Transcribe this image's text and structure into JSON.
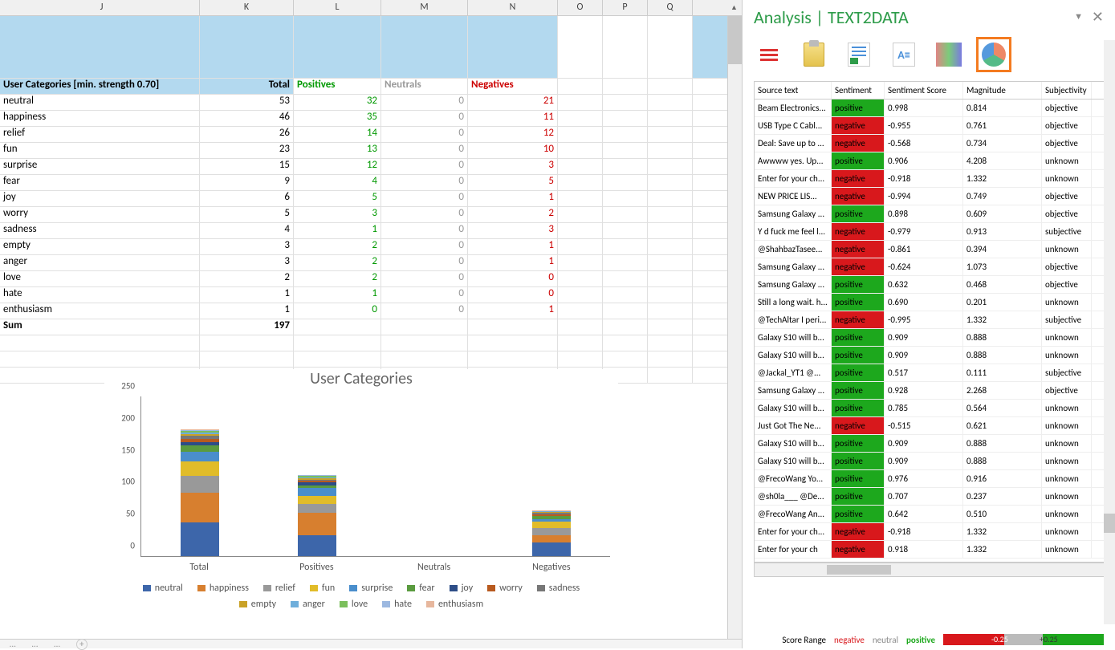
{
  "panel": {
    "title_a": "Analysis",
    "title_b": "TEXT2DATA"
  },
  "colHeaders": [
    "J",
    "K",
    "L",
    "M",
    "N",
    "O",
    "P",
    "Q"
  ],
  "table": {
    "header": {
      "j": "User Categories [min. strength 0.70]",
      "k": "Total",
      "l": "Positives",
      "m": "Neutrals",
      "n": "Negatives"
    },
    "rows": [
      {
        "j": "neutral",
        "k": 53,
        "l": 32,
        "m": 0,
        "n": 21
      },
      {
        "j": "happiness",
        "k": 46,
        "l": 35,
        "m": 0,
        "n": 11
      },
      {
        "j": "relief",
        "k": 26,
        "l": 14,
        "m": 0,
        "n": 12
      },
      {
        "j": "fun",
        "k": 23,
        "l": 13,
        "m": 0,
        "n": 10
      },
      {
        "j": "surprise",
        "k": 15,
        "l": 12,
        "m": 0,
        "n": 3
      },
      {
        "j": "fear",
        "k": 9,
        "l": 4,
        "m": 0,
        "n": 5
      },
      {
        "j": "joy",
        "k": 6,
        "l": 5,
        "m": 0,
        "n": 1
      },
      {
        "j": "worry",
        "k": 5,
        "l": 3,
        "m": 0,
        "n": 2
      },
      {
        "j": "sadness",
        "k": 4,
        "l": 1,
        "m": 0,
        "n": 3
      },
      {
        "j": "empty",
        "k": 3,
        "l": 2,
        "m": 0,
        "n": 1
      },
      {
        "j": "anger",
        "k": 3,
        "l": 2,
        "m": 0,
        "n": 1
      },
      {
        "j": "love",
        "k": 2,
        "l": 2,
        "m": 0,
        "n": 0
      },
      {
        "j": "hate",
        "k": 1,
        "l": 1,
        "m": 0,
        "n": 0
      },
      {
        "j": "enthusiasm",
        "k": 1,
        "l": 0,
        "m": 0,
        "n": 1
      }
    ],
    "sum": {
      "j": "Sum",
      "k": 197
    }
  },
  "chart_data": {
    "type": "bar",
    "title": "User Categories",
    "categories": [
      "Total",
      "Positives",
      "Neutrals",
      "Negatives"
    ],
    "ylim": [
      0,
      250
    ],
    "yticks": [
      0,
      50,
      100,
      150,
      200,
      250
    ],
    "series": [
      {
        "name": "neutral",
        "color": "#3d66aa",
        "values": [
          53,
          32,
          0,
          21
        ]
      },
      {
        "name": "happiness",
        "color": "#d77f2f",
        "values": [
          46,
          35,
          0,
          11
        ]
      },
      {
        "name": "relief",
        "color": "#999999",
        "values": [
          26,
          14,
          0,
          12
        ]
      },
      {
        "name": "fun",
        "color": "#e1bc29",
        "values": [
          23,
          13,
          0,
          10
        ]
      },
      {
        "name": "surprise",
        "color": "#4a8ecc",
        "values": [
          15,
          12,
          0,
          3
        ]
      },
      {
        "name": "fear",
        "color": "#5a9b3f",
        "values": [
          9,
          4,
          0,
          5
        ]
      },
      {
        "name": "joy",
        "color": "#2d4d87",
        "values": [
          6,
          5,
          0,
          1
        ]
      },
      {
        "name": "worry",
        "color": "#b85a1f",
        "values": [
          5,
          3,
          0,
          2
        ]
      },
      {
        "name": "sadness",
        "color": "#777777",
        "values": [
          4,
          1,
          0,
          3
        ]
      },
      {
        "name": "empty",
        "color": "#c9a227",
        "values": [
          3,
          2,
          0,
          1
        ]
      },
      {
        "name": "anger",
        "color": "#6faedb",
        "values": [
          3,
          2,
          0,
          1
        ]
      },
      {
        "name": "love",
        "color": "#7bbf5c",
        "values": [
          2,
          2,
          0,
          0
        ]
      },
      {
        "name": "hate",
        "color": "#9cb8e0",
        "values": [
          1,
          1,
          0,
          0
        ]
      },
      {
        "name": "enthusiasm",
        "color": "#e7b79d",
        "values": [
          1,
          0,
          0,
          1
        ]
      }
    ]
  },
  "analysis": {
    "headers": [
      "Source text",
      "Sentiment",
      "Sentiment Score",
      "Magnitude",
      "Subjectivity"
    ],
    "rows": [
      {
        "t": "Beam Electronics...",
        "s": "positive",
        "sc": "0.998",
        "m": "0.814",
        "sub": "objective"
      },
      {
        "t": "USB Type C Cabl...",
        "s": "negative",
        "sc": "-0.955",
        "m": "0.761",
        "sub": "objective"
      },
      {
        "t": "Deal: Save up to ...",
        "s": "negative",
        "sc": "-0.568",
        "m": "0.734",
        "sub": "objective"
      },
      {
        "t": "Awwww yes. Up...",
        "s": "positive",
        "sc": "0.906",
        "m": "4.208",
        "sub": "unknown"
      },
      {
        "t": "Enter for your ch...",
        "s": "negative",
        "sc": "-0.918",
        "m": "1.332",
        "sub": "unknown"
      },
      {
        "t": "NEW PRICE LIS...",
        "s": "negative",
        "sc": "-0.994",
        "m": "0.749",
        "sub": "objective"
      },
      {
        "t": "Samsung Galaxy ...",
        "s": "positive",
        "sc": "0.898",
        "m": "0.609",
        "sub": "objective"
      },
      {
        "t": "Y d fuck me feel l...",
        "s": "negative",
        "sc": "-0.979",
        "m": "0.913",
        "sub": "subjective"
      },
      {
        "t": "@ShahbazTasee...",
        "s": "negative",
        "sc": "-0.861",
        "m": "0.394",
        "sub": "unknown"
      },
      {
        "t": "Samsung Galaxy ...",
        "s": "negative",
        "sc": "-0.624",
        "m": "1.073",
        "sub": "objective"
      },
      {
        "t": "Samsung Galaxy ...",
        "s": "positive",
        "sc": "0.632",
        "m": "0.468",
        "sub": "objective"
      },
      {
        "t": "Still a long wait. h...",
        "s": "positive",
        "sc": "0.690",
        "m": "0.201",
        "sub": "unknown"
      },
      {
        "t": "@TechAltar I peri...",
        "s": "negative",
        "sc": "-0.995",
        "m": "1.332",
        "sub": "subjective"
      },
      {
        "t": "Galaxy S10 will b...",
        "s": "positive",
        "sc": "0.909",
        "m": "0.888",
        "sub": "unknown"
      },
      {
        "t": "Galaxy S10 will b...",
        "s": "positive",
        "sc": "0.909",
        "m": "0.888",
        "sub": "unknown"
      },
      {
        "t": "@Jackal_YT1 @...",
        "s": "positive",
        "sc": "0.517",
        "m": "0.111",
        "sub": "subjective"
      },
      {
        "t": "Samsung Galaxy ...",
        "s": "positive",
        "sc": "0.928",
        "m": "2.268",
        "sub": "objective"
      },
      {
        "t": "Galaxy S10 will b...",
        "s": "positive",
        "sc": "0.785",
        "m": "0.564",
        "sub": "unknown"
      },
      {
        "t": "Just Got The Ne...",
        "s": "negative",
        "sc": "-0.515",
        "m": "0.621",
        "sub": "unknown"
      },
      {
        "t": "Galaxy S10 will b...",
        "s": "positive",
        "sc": "0.909",
        "m": "0.888",
        "sub": "unknown"
      },
      {
        "t": "Galaxy S10 will b...",
        "s": "positive",
        "sc": "0.909",
        "m": "0.888",
        "sub": "unknown"
      },
      {
        "t": "@FrecoWang Yo...",
        "s": "positive",
        "sc": "0.976",
        "m": "0.916",
        "sub": "unknown"
      },
      {
        "t": "@sh0la___ @De...",
        "s": "positive",
        "sc": "0.707",
        "m": "0.237",
        "sub": "unknown"
      },
      {
        "t": "@FrecoWang An...",
        "s": "positive",
        "sc": "0.642",
        "m": "0.510",
        "sub": "unknown"
      },
      {
        "t": "Enter for your ch...",
        "s": "negative",
        "sc": "-0.918",
        "m": "1.332",
        "sub": "unknown"
      },
      {
        "t": "Enter for your ch",
        "s": "negative",
        "sc": "0.918",
        "m": "1.332",
        "sub": "unknown"
      }
    ]
  },
  "scoreRange": {
    "label": "Score Range",
    "neg": "negative",
    "neu": "neutral",
    "pos": "positive",
    "min": "-1",
    "lowmark": "-0.25",
    "highmark": "+0.25",
    "max": "+1"
  }
}
